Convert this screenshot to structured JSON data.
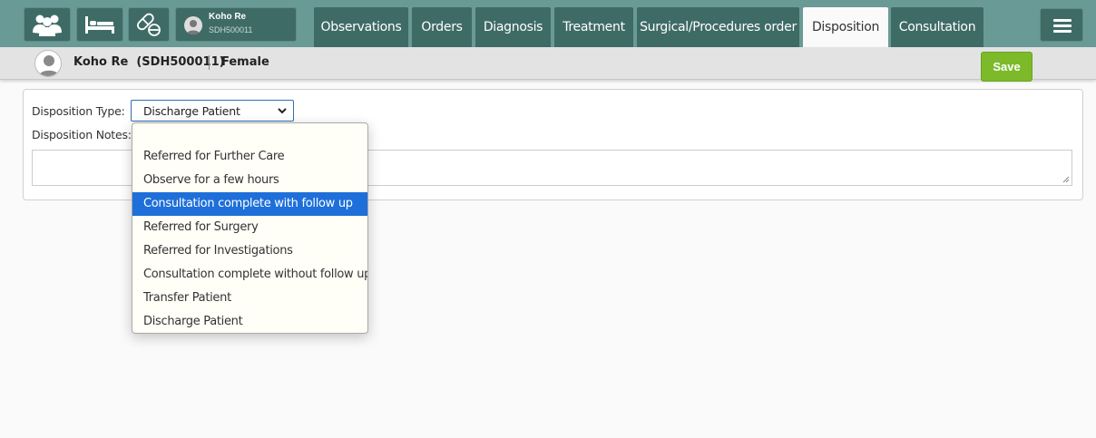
{
  "topbar": {
    "patient_chip": {
      "name": "Koho Re",
      "id": "SDH500011"
    },
    "tabs": [
      {
        "label": "Observations",
        "active": false
      },
      {
        "label": "Orders",
        "active": false
      },
      {
        "label": "Diagnosis",
        "active": false
      },
      {
        "label": "Treatment",
        "active": false
      },
      {
        "label": "Surgical/Procedures order",
        "active": false
      },
      {
        "label": "Disposition",
        "active": true
      },
      {
        "label": "Consultation",
        "active": false
      }
    ],
    "icons": [
      "patients-icon",
      "bed-icon",
      "pills-icon",
      "avatar-icon",
      "hamburger-menu-icon"
    ]
  },
  "patient_strip": {
    "name_id": "Koho Re  (SDH500011)",
    "gender": "Female"
  },
  "save_button": {
    "label": "Save",
    "color": "#7cba2a"
  },
  "form": {
    "disposition_type_label": "Disposition Type:",
    "disposition_type_value": "Discharge Patient",
    "disposition_notes_label": "Disposition Notes:",
    "disposition_notes_value": ""
  },
  "dropdown": {
    "highlighted_index": 3,
    "options": [
      "",
      "Referred for Further Care",
      "Observe for a few hours",
      "Consultation complete with follow up",
      "Referred for Surgery",
      "Referred for Investigations",
      "Consultation complete without follow up",
      "Transfer Patient",
      "Discharge Patient"
    ]
  },
  "colors": {
    "topbar": "#6a9a95",
    "tab": "#3f6b66",
    "highlight": "#1e6fd9"
  }
}
